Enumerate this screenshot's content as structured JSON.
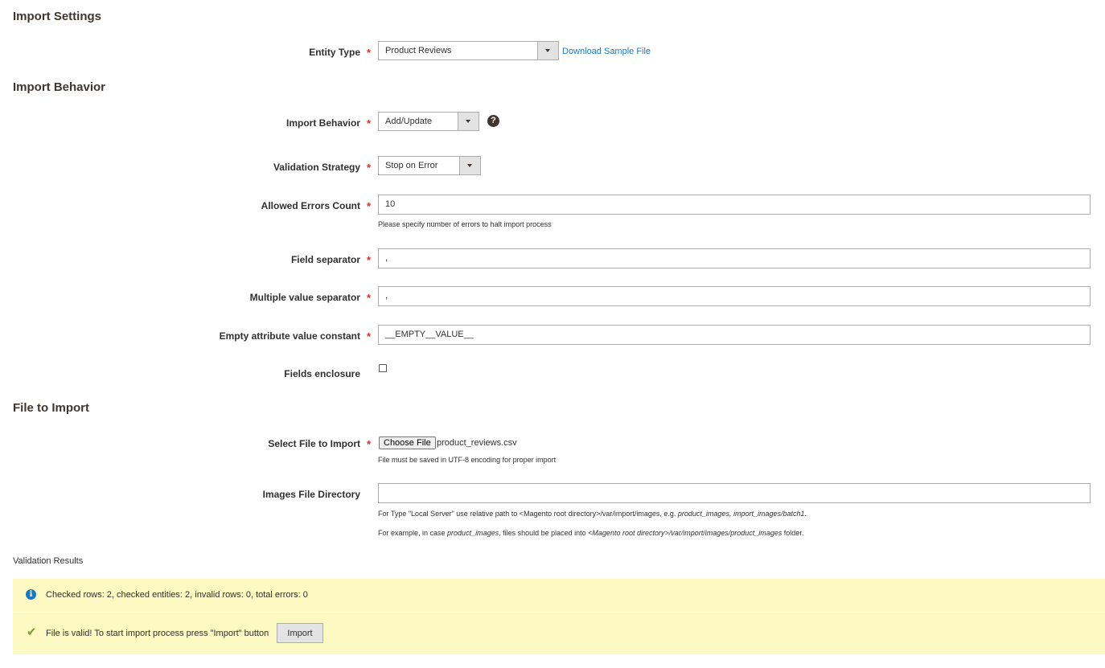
{
  "sections": {
    "import_settings": "Import Settings",
    "import_behavior": "Import Behavior",
    "file_to_import": "File to Import"
  },
  "entity_type": {
    "label": "Entity Type",
    "required": "*",
    "value": "Product Reviews",
    "download_link": "Download Sample File"
  },
  "behavior": {
    "label": "Import Behavior",
    "required": "*",
    "value": "Add/Update",
    "help_icon": "?"
  },
  "validation_strategy": {
    "label": "Validation Strategy",
    "required": "*",
    "value": "Stop on Error"
  },
  "allowed_errors": {
    "label": "Allowed Errors Count",
    "required": "*",
    "value": "10",
    "note": "Please specify number of errors to halt import process"
  },
  "field_separator": {
    "label": "Field separator",
    "required": "*",
    "value": ","
  },
  "multiple_value_separator": {
    "label": "Multiple value separator",
    "required": "*",
    "value": ","
  },
  "empty_attribute": {
    "label": "Empty attribute value constant",
    "required": "*",
    "value": "__EMPTY__VALUE__"
  },
  "fields_enclosure": {
    "label": "Fields enclosure",
    "checked": false
  },
  "select_file": {
    "label": "Select File to Import",
    "required": "*",
    "button": "Choose File",
    "file_name": "product_reviews.csv",
    "note": "File must be saved in UTF-8 encoding for proper import"
  },
  "images_dir": {
    "label": "Images File Directory",
    "value": "",
    "note1_a": "For Type \"Local Server\" use relative path to <Magento root directory>/var/import/images, e.g. ",
    "note1_b": "product_images, import_images/batch1",
    "note1_c": ".",
    "note2_a": "For example, in case ",
    "note2_b": "product_images",
    "note2_c": ", files should be placed into ",
    "note2_d": "<Magento root directory>/var/import/images/product_images",
    "note2_e": " folder."
  },
  "validation_results": {
    "title": "Validation Results",
    "info_icon": "i",
    "info_text": "Checked rows: 2, checked entities: 2, invalid rows: 0, total errors: 0",
    "success_icon": "✔",
    "success_text": "File is valid! To start import process press \"Import\" button",
    "import_button": "Import"
  },
  "colors": {
    "accent_link": "#1979c3",
    "required": "#e22626",
    "message_bg": "#fdf9c2",
    "success": "#79a22e"
  }
}
